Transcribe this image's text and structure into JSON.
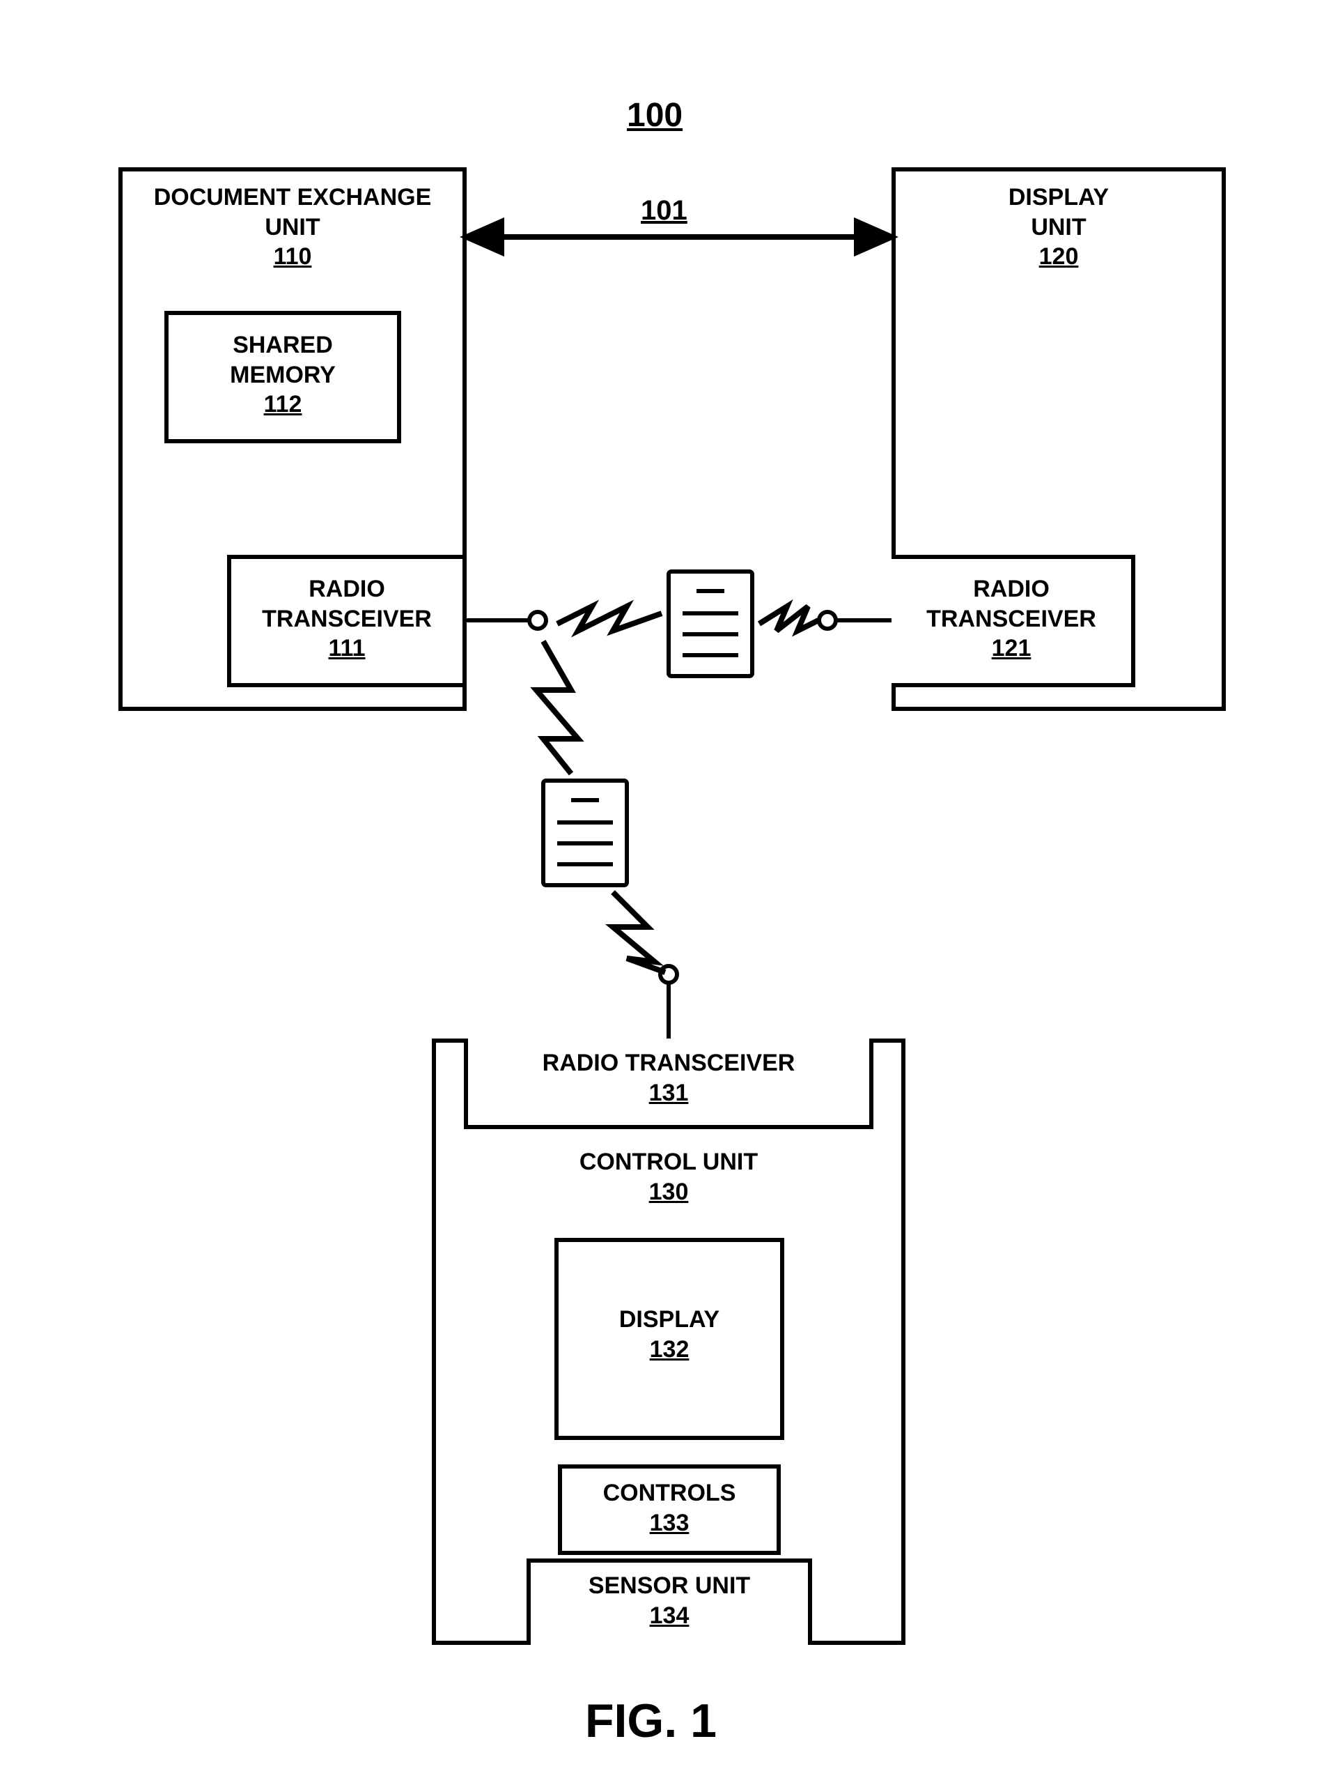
{
  "figure": {
    "system_ref": "100",
    "link_ref": "101",
    "caption": "FIG. 1"
  },
  "doc_exchange": {
    "title": "DOCUMENT EXCHANGE\nUNIT",
    "ref": "110",
    "shared_memory": {
      "title": "SHARED\nMEMORY",
      "ref": "112"
    },
    "radio": {
      "title": "RADIO\nTRANSCEIVER",
      "ref": "111"
    }
  },
  "display_unit": {
    "title": "DISPLAY\nUNIT",
    "ref": "120",
    "radio": {
      "title": "RADIO\nTRANSCEIVER",
      "ref": "121"
    }
  },
  "control_unit": {
    "title": "CONTROL UNIT",
    "ref": "130",
    "radio": {
      "title": "RADIO TRANSCEIVER",
      "ref": "131"
    },
    "display": {
      "title": "DISPLAY",
      "ref": "132"
    },
    "controls": {
      "title": "CONTROLS",
      "ref": "133"
    },
    "sensor": {
      "title": "SENSOR UNIT",
      "ref": "134"
    }
  }
}
